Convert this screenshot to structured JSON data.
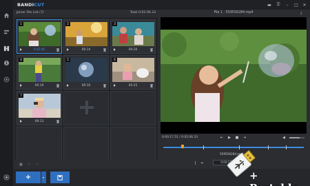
{
  "app": {
    "logo_main": "BANDI",
    "logo_accent": "CUT"
  },
  "joiner": {
    "header_left": "Joiner File List (7)",
    "header_right": "Total 0:02:06.33",
    "clips": [
      {
        "number": "1",
        "time": "0:02:06",
        "time_color": "blue",
        "selected": true
      },
      {
        "number": "2",
        "time": "00:14"
      },
      {
        "number": "3",
        "time": "00:20"
      },
      {
        "number": "4",
        "time": "00:19"
      },
      {
        "number": "5",
        "time": "00:10"
      },
      {
        "number": "6",
        "time": "05:25"
      },
      {
        "number": "7",
        "time": "00:13"
      }
    ]
  },
  "preview": {
    "title": "File 1 : 559556284.mp4",
    "time_display": "0:00:17.51 / 0:02:06.33",
    "segment_label": "559556284.mp4",
    "cut_time": "0:00:17.5"
  },
  "watermark": {
    "text": "+ Portable"
  },
  "colors": {
    "accent": "#3d8be0",
    "playhead": "#f0a030",
    "background": "#2b2d31"
  }
}
